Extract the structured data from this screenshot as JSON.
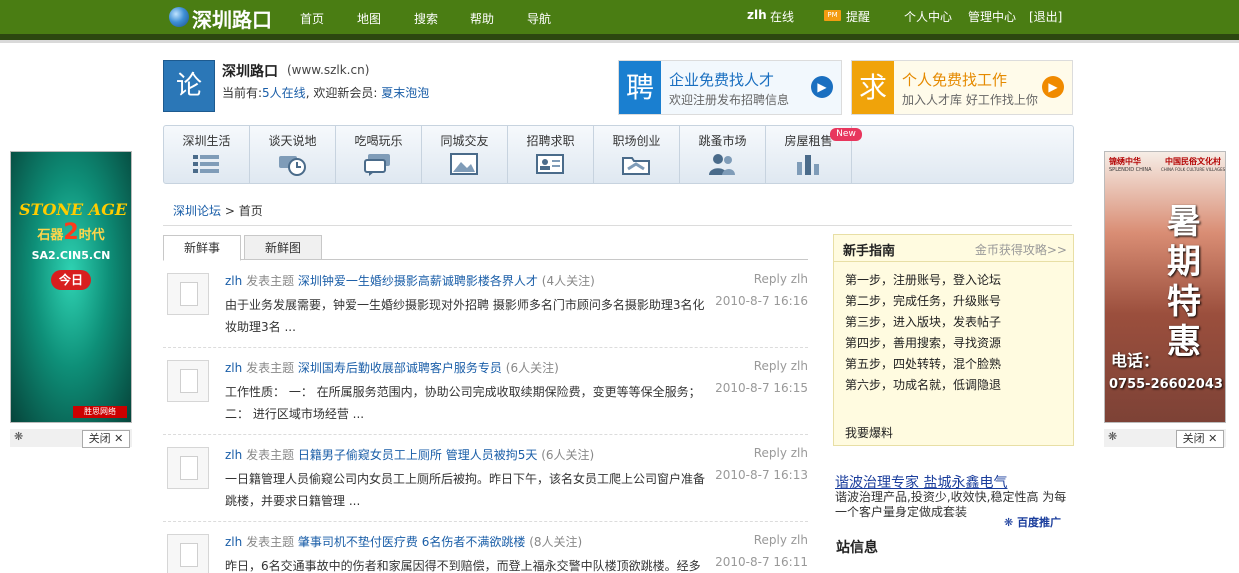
{
  "header": {
    "logo": "深圳路口",
    "nav": [
      "首页",
      "地图",
      "搜索",
      "帮助",
      "导航"
    ],
    "user": "zlh",
    "online": "在线",
    "pm_badge": "PM",
    "remind": "提醒",
    "personal": "个人中心",
    "admin": "管理中心",
    "logout": "[退出]"
  },
  "site": {
    "icon_char": "论",
    "name": "深圳路口",
    "url": "(www.szlk.cn)",
    "online_prefix": "当前有:",
    "online_count": "5人在线",
    "welcome": ", 欢迎新会员:",
    "new_member": "夏末泡泡"
  },
  "promos": [
    {
      "icon": "聘",
      "title": "企业免费找人才",
      "sub": "欢迎注册发布招聘信息",
      "color": "#1a7fd0",
      "arrow": "#1a6fc0"
    },
    {
      "icon": "求",
      "title": "个人免费找工作",
      "sub": "加入人才库  好工作找上你",
      "color": "#f0a30a",
      "arrow": "#f08a00"
    }
  ],
  "categories": [
    {
      "label": "深圳生活",
      "icon": "list-icon"
    },
    {
      "label": "谈天说地",
      "icon": "chat-clock-icon"
    },
    {
      "label": "吃喝玩乐",
      "icon": "speech-bubble-icon"
    },
    {
      "label": "同城交友",
      "icon": "picture-icon"
    },
    {
      "label": "招聘求职",
      "icon": "id-card-icon"
    },
    {
      "label": "职场创业",
      "icon": "folder-icon"
    },
    {
      "label": "跳蚤市场",
      "icon": "people-icon"
    },
    {
      "label": "房屋租售",
      "icon": "bar-chart-icon"
    }
  ],
  "new_badge": "New",
  "breadcrumb": {
    "root": "深圳论坛",
    "sep": ">",
    "current": "首页"
  },
  "tabs": [
    "新鲜事",
    "新鲜图"
  ],
  "feed": [
    {
      "author": "zlh",
      "action": "发表主题",
      "title": "深圳钟爱一生婚纱摄影高薪诚聘影楼各界人才",
      "watch": "(4人关注)",
      "reply": "Reply zlh",
      "date": "2010-8-7 16:16",
      "body": "由于业务发展需要，钟爱一生婚纱摄影现对外招聘 摄影师多名门市顾问多名摄影助理3名化妆助理3名 ..."
    },
    {
      "author": "zlh",
      "action": "发表主题",
      "title": "深圳国寿后勤收展部诚聘客户服务专员",
      "watch": "(6人关注)",
      "reply": "Reply zlh",
      "date": "2010-8-7 16:15",
      "body": "工作性质： 一： 在所属服务范围内，协助公司完成收取续期保险费，变更等等保全服务；二： 进行区域市场经营 ..."
    },
    {
      "author": "zlh",
      "action": "发表主题",
      "title": "日籍男子偷窥女员工上厕所 管理人员被拘5天",
      "watch": "(6人关注)",
      "reply": "Reply zlh",
      "date": "2010-8-7 16:13",
      "body": "一日籍管理人员偷窥公司内女员工上厕所后被拘。昨日下午，该名女员工爬上公司窗户准备跳楼，并要求日籍管理 ..."
    },
    {
      "author": "zlh",
      "action": "发表主题",
      "title": "肇事司机不垫付医疗费 6名伤者不满欲跳楼",
      "watch": "(8人关注)",
      "reply": "Reply zlh",
      "date": "2010-8-7 16:11",
      "body": "昨日，6名交通事故中的伤者和家属因得不到赔偿，而登上福永交警中队楼顶欲跳楼。经多"
    }
  ],
  "guide": {
    "title": "新手指南",
    "link": "金币获得攻略>>",
    "steps": [
      "第一步，注册账号，登入论坛",
      "第二步，完成任务，升级账号",
      "第三步，进入版块，发表帖子",
      "第四步，善用搜索，寻找资源",
      "第五步，四处转转，混个脸熟",
      "第六步，功成名就，低调隐退"
    ],
    "bottom": "我要爆料"
  },
  "ad": {
    "title": "谐波治理专家 盐城永鑫电气",
    "desc": "谐波治理产品,投资少,收效快,稳定性高 为每一个客户量身定做成套装",
    "baidu": "百度推广"
  },
  "station_title": "站信息",
  "side_left": {
    "title": "STONE AGE",
    "sub1": "石器",
    "num": "2",
    "sub2": "时代",
    "site": "SA2.CIN5.CN",
    "today": "今日",
    "corner": "胜思网络",
    "close": "关闭"
  },
  "side_right": {
    "brand": "锦绣中华",
    "brand_en": "SPLENDID CHINA",
    "village": "中国民俗文化村",
    "village_en": "CHINA FOLK CULTURE VILLAGES",
    "promo": "暑期特惠",
    "tel_label": "电话：",
    "tel": "0755-26602043",
    "close": "关闭"
  }
}
